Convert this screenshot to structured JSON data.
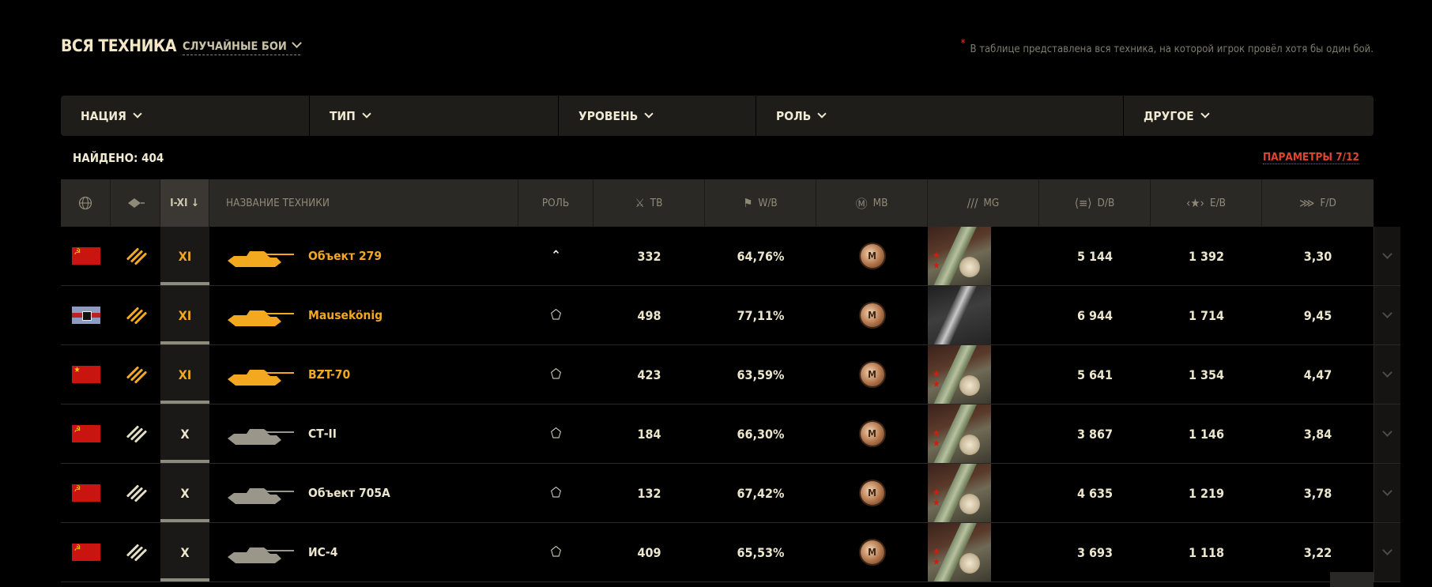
{
  "header": {
    "title": "ВСЯ ТЕХНИКА",
    "mode_select": "СЛУЧАЙНЫЕ БОИ",
    "note_star": "*",
    "note": "В таблице представлена вся техника, на которой игрок провёл хотя бы один бой."
  },
  "filters": [
    {
      "label": "НАЦИЯ"
    },
    {
      "label": "ТИП"
    },
    {
      "label": "УРОВЕНЬ"
    },
    {
      "label": "РОЛЬ"
    },
    {
      "label": "ДРУГОЕ"
    }
  ],
  "found": "НАЙДЕНО: 404",
  "params_link": "ПАРАМЕТРЫ 7/12",
  "table": {
    "headers": {
      "level": "I-XI ↓",
      "name": "НАЗВАНИЕ ТЕХНИКИ",
      "role": "РОЛЬ",
      "battles": "ТВ",
      "winrate": "W/B",
      "mastery": "MB",
      "marks": "MG",
      "damage": "D/B",
      "exp": "E/B",
      "frags": "F/D"
    },
    "header_icons": {
      "nation": "globe-icon",
      "type": "tank-type-icon",
      "battles": "crossed-swords-icon",
      "winrate": "flag-icon",
      "mastery": "mastery-wreath-icon",
      "marks": "gun-marks-icon",
      "damage": "damage-icon",
      "exp": "experience-star-icon",
      "frags": "frags-icon"
    },
    "rows": [
      {
        "nation": "ussr",
        "type": "heavy-tank",
        "premium": true,
        "level": "XI",
        "name": "Объект 279",
        "role_icon": "⌃",
        "battles": "332",
        "winrate": "64,76%",
        "mastery": "M",
        "damage": "5 144",
        "exp": "1 392",
        "frags": "3,30"
      },
      {
        "nation": "germany",
        "type": "heavy-tank",
        "premium": true,
        "level": "XI",
        "name": "Mausekönig",
        "role_icon": "⬠",
        "battles": "498",
        "winrate": "77,11%",
        "mastery": "M",
        "damage": "6 944",
        "exp": "1 714",
        "frags": "9,45"
      },
      {
        "nation": "china",
        "type": "heavy-tank",
        "premium": true,
        "level": "XI",
        "name": "BZT-70",
        "role_icon": "⬠",
        "battles": "423",
        "winrate": "63,59%",
        "mastery": "M",
        "damage": "5 641",
        "exp": "1 354",
        "frags": "4,47"
      },
      {
        "nation": "ussr",
        "type": "heavy-tank",
        "premium": false,
        "level": "X",
        "name": "СТ-II",
        "role_icon": "⬠",
        "battles": "184",
        "winrate": "66,30%",
        "mastery": "M",
        "damage": "3 867",
        "exp": "1 146",
        "frags": "3,84"
      },
      {
        "nation": "ussr",
        "type": "heavy-tank",
        "premium": false,
        "level": "X",
        "name": "Объект 705А",
        "role_icon": "⬠",
        "battles": "132",
        "winrate": "67,42%",
        "mastery": "M",
        "damage": "4 635",
        "exp": "1 219",
        "frags": "3,78"
      },
      {
        "nation": "ussr",
        "type": "heavy-tank",
        "premium": false,
        "level": "X",
        "name": "ИС-4",
        "role_icon": "⬠",
        "battles": "409",
        "winrate": "65,53%",
        "mastery": "M",
        "damage": "3 693",
        "exp": "1 118",
        "frags": "3,22"
      }
    ]
  },
  "colors": {
    "accent_gold": "#f2a920",
    "link_red": "#e0452e",
    "text": "#ece6cd",
    "background": "#000000"
  }
}
